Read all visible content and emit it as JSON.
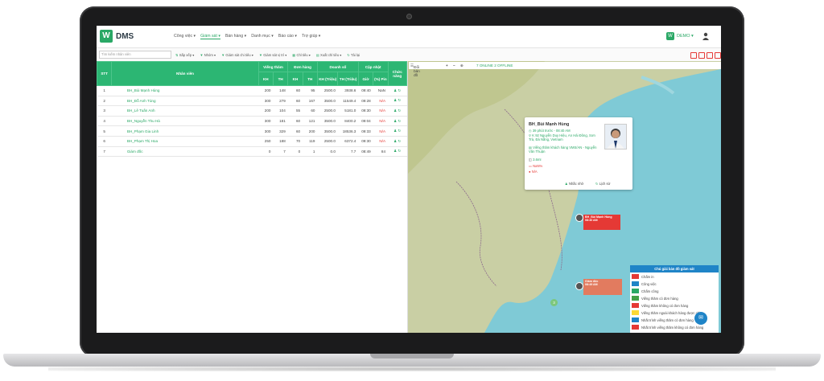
{
  "app": {
    "logo_letter": "W",
    "title": "DMS",
    "user_label": "DEMO"
  },
  "nav": {
    "items": [
      "Công việc",
      "Giám sát",
      "Bán hàng",
      "Danh mục",
      "Báo cáo",
      "Trợ giúp"
    ],
    "active_index": 1
  },
  "toolbar": {
    "search_placeholder": "Tìm kiếm nhân viên",
    "sort": "Sắp xếp",
    "filter": "Nhóm",
    "monitor_by": "Giám sát chi tiêu",
    "monitor_pos": "Giám sát vị trí",
    "kpi": "Chỉ tiêu",
    "export_kpi": "Xuất chỉ tiêu",
    "reload": "Tải lại"
  },
  "table": {
    "headers": {
      "stt": "STT",
      "employee": "Nhân viên",
      "visits": "Viếng thăm",
      "orders": "Đơn hàng",
      "revenue": "Doanh số",
      "updated": "Cập nhật",
      "functions": "Chức năng",
      "kh": "KH",
      "th": "TH",
      "kh_sub": "KH (Triệu)",
      "th_sub": "TH (Triệu)",
      "time": "Giờ",
      "pin": "(%) Pin"
    },
    "rows": [
      {
        "stt": "1",
        "name": "BH_Bùi Mạnh Hùng",
        "v_kh": "200",
        "v_th": "148",
        "o_kh": "60",
        "o_th": "95",
        "r_kh": "2500.0",
        "r_th": "3938.6",
        "time": "09:40",
        "pin": "NaN",
        "pin_red": false
      },
      {
        "stt": "2",
        "name": "BH_Đỗ Anh Tùng",
        "v_kh": "300",
        "v_th": "279",
        "o_kh": "60",
        "o_th": "167",
        "r_kh": "3500.0",
        "r_th": "11549.4",
        "time": "09:28",
        "pin": "N/A",
        "pin_red": true
      },
      {
        "stt": "3",
        "name": "BH_Lê Tuấn Anh",
        "v_kh": "200",
        "v_th": "104",
        "o_kh": "55",
        "o_th": "60",
        "r_kh": "2500.0",
        "r_th": "5181.0",
        "time": "09:30",
        "pin": "N/A",
        "pin_red": true
      },
      {
        "stt": "4",
        "name": "BH_Nguyễn Thu Hà",
        "v_kh": "300",
        "v_th": "181",
        "o_kh": "60",
        "o_th": "121",
        "r_kh": "3500.0",
        "r_th": "8400.2",
        "time": "09:04",
        "pin": "N/A",
        "pin_red": true
      },
      {
        "stt": "5",
        "name": "BH_Phạm Gia Linh",
        "v_kh": "300",
        "v_th": "329",
        "o_kh": "60",
        "o_th": "200",
        "r_kh": "3500.0",
        "r_th": "18536.3",
        "time": "09:33",
        "pin": "N/A",
        "pin_red": true
      },
      {
        "stt": "6",
        "name": "BH_Phạm Thị Hoa",
        "v_kh": "250",
        "v_th": "188",
        "o_kh": "70",
        "o_th": "119",
        "r_kh": "2500.0",
        "r_th": "6372.4",
        "time": "09:30",
        "pin": "N/A",
        "pin_red": true
      },
      {
        "stt": "7",
        "name": "Giám đốc",
        "v_kh": "0",
        "v_th": "7",
        "o_kh": "0",
        "o_th": "1",
        "r_kh": "0.0",
        "r_th": "7.7",
        "time": "08:49",
        "pin": "84",
        "pin_red": false
      }
    ]
  },
  "map": {
    "toolbar": {
      "map_label": "Đổi bản đồ",
      "status": "7 ONLINE 2 OFFLINE"
    },
    "popup": {
      "name": "BH_Bùi Mạnh Hùng",
      "ago": "39 phút trước - 08:40 AM",
      "address": "K 92 Nguyễn Duy Hiệu, An Hải Đông, Sơn Trà, Đà Nẵng, Vietnam",
      "visit": "Viếng thăm khách hàng VMS/AN - Nguyễn Văn Thuận",
      "distance": "3.6mI",
      "speed": "NaN%",
      "status": "N/A",
      "remind": "Nhắc nhở",
      "history": "Lịch sử"
    },
    "markers": [
      {
        "label": "BH_Bùi Mạnh Hùng",
        "time": "08:40 AM"
      },
      {
        "label": "Giám đốc",
        "time": "08:49 AM"
      }
    ],
    "cluster": "3",
    "legend": {
      "title": "Chú giải bản đồ giám sát",
      "items": [
        {
          "label": "Chấm in",
          "color": "#e53935"
        },
        {
          "label": "Công việc",
          "color": "#1f84c7"
        },
        {
          "label": "Chấm công",
          "color": "#2aa866"
        },
        {
          "label": "Viếng thăm có đơn hàng",
          "color": "#43a047"
        },
        {
          "label": "Viếng thăm không có đơn hàng",
          "color": "#e53935"
        },
        {
          "label": "Viếng thăm ngoài khách hàng được chia",
          "color": "#fdd835"
        },
        {
          "label": "Nhắt trình viếng thăm có đơn hàng",
          "color": "#1f84c7"
        },
        {
          "label": "Nhắt trình viếng thăm không có đơn hàng",
          "color": "#e53935"
        }
      ]
    }
  }
}
